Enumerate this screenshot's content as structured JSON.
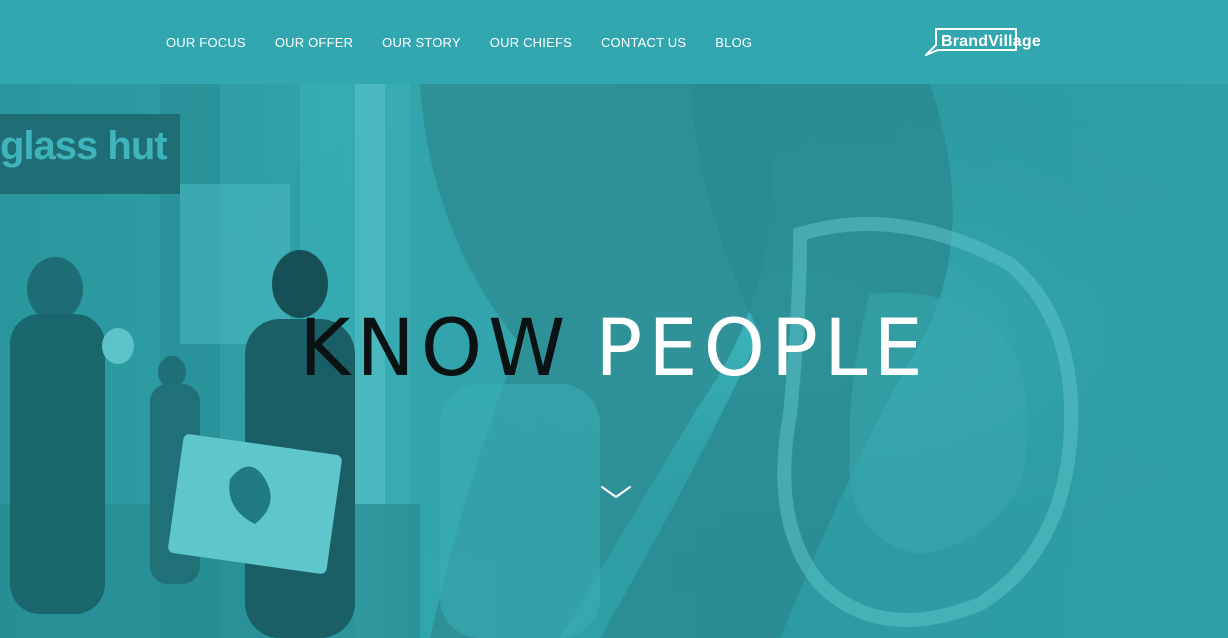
{
  "nav": {
    "items": [
      {
        "label": "OUR FOCUS"
      },
      {
        "label": "OUR OFFER"
      },
      {
        "label": "OUR STORY"
      },
      {
        "label": "OUR CHIEFS"
      },
      {
        "label": "CONTACT US"
      },
      {
        "label": "BLOG"
      }
    ]
  },
  "brand": {
    "name": "BrandVillage"
  },
  "hero": {
    "sign_text": "glass hut",
    "headline_dark": "KNOW",
    "headline_light": "PEOPLE",
    "scroll_icon": "chevron-down-icon"
  },
  "colors": {
    "header": "#33a7b0",
    "overlay": "#2f9ea6",
    "headline_dark": "#0b1213",
    "headline_light": "#ffffff"
  }
}
